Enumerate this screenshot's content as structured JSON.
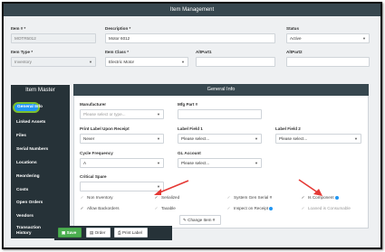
{
  "header": {
    "title": "Item Management"
  },
  "top_fields": {
    "item_num": {
      "label": "Item # *",
      "value": "MOTR5012"
    },
    "description": {
      "label": "Description *",
      "value": "Motor 6012"
    },
    "status": {
      "label": "Status",
      "value": "Active"
    },
    "item_type": {
      "label": "Item Type *",
      "value": "Inventory"
    },
    "item_class": {
      "label": "Item Class *",
      "value": "Electric Motor"
    },
    "alt_part1": {
      "label": "AltPart1",
      "value": ""
    },
    "alt_part2": {
      "label": "AltPart2",
      "value": ""
    }
  },
  "sidebar": {
    "title": "Item Master",
    "items": [
      {
        "label": "General Info"
      },
      {
        "label": "Linked Assets"
      },
      {
        "label": "Files"
      },
      {
        "label": "Serial Numbers"
      },
      {
        "label": "Locations"
      },
      {
        "label": "Reordering"
      },
      {
        "label": "Costs"
      },
      {
        "label": "Open Orders"
      },
      {
        "label": "Vendors"
      },
      {
        "label": "Transaction History"
      }
    ]
  },
  "panel": {
    "title": "General Info",
    "manufacturer": {
      "label": "Manufacturer",
      "placeholder": "Please select or type..."
    },
    "mfg_part": {
      "label": "Mfg Part #",
      "value": ""
    },
    "print_label": {
      "label": "Print Label Upon Receipt",
      "value": "Never"
    },
    "label_field1": {
      "label": "Label Field 1",
      "value": "Please select..."
    },
    "label_field2": {
      "label": "Label Field 2",
      "value": "Please select..."
    },
    "cycle_freq": {
      "label": "Cycle Frequency",
      "value": "A"
    },
    "gl_account": {
      "label": "GL Account",
      "value": "Please select..."
    },
    "critical_spare": {
      "label": "Critical Spare",
      "value": ""
    },
    "checkboxes": [
      {
        "label": "Non Inventory",
        "checked": false
      },
      {
        "label": "Serialized",
        "checked": true
      },
      {
        "label": "System Gen Serial #",
        "checked": false
      },
      {
        "label": "Is Component",
        "checked": true
      },
      {
        "label": "Allow Backorders",
        "checked": true
      },
      {
        "label": "Taxable",
        "checked": false
      },
      {
        "label": "Inspect on Receipt",
        "checked": false
      },
      {
        "label": "Loaned is Consumable",
        "checked": false
      }
    ],
    "change_item_label": "Change Item #"
  },
  "footer": {
    "save_label": "Save",
    "order_label": "Order",
    "print_label": "Print Label"
  },
  "colors": {
    "header_bg": "#37474f",
    "sidebar_bg": "#263238",
    "active_tab": "#2196f3",
    "active_outline": "#7cbf2c",
    "save_green": "#4caf50",
    "annotation_red": "#e53935"
  }
}
